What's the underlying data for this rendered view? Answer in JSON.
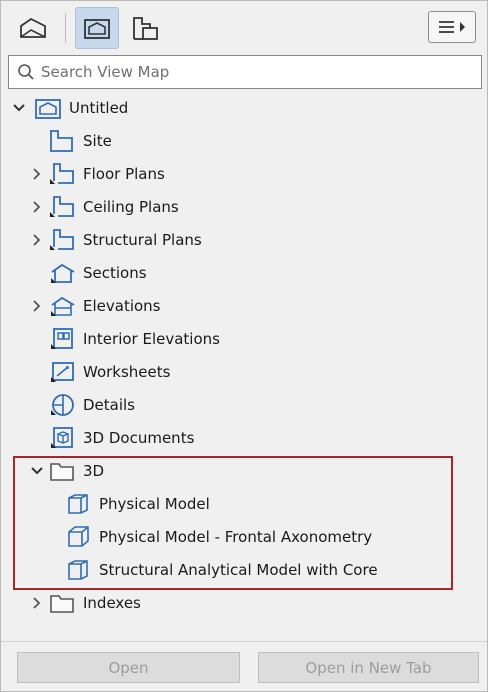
{
  "search": {
    "placeholder": "Search View Map"
  },
  "tree": {
    "root": {
      "label": "Untitled"
    },
    "items": [
      {
        "label": "Site"
      },
      {
        "label": "Floor Plans"
      },
      {
        "label": "Ceiling Plans"
      },
      {
        "label": "Structural Plans"
      },
      {
        "label": "Sections"
      },
      {
        "label": "Elevations"
      },
      {
        "label": "Interior Elevations"
      },
      {
        "label": "Worksheets"
      },
      {
        "label": "Details"
      },
      {
        "label": "3D Documents"
      },
      {
        "label": "3D"
      },
      {
        "label": "Physical Model"
      },
      {
        "label": "Physical Model - Frontal Axonometry"
      },
      {
        "label": "Structural Analytical Model with Core"
      },
      {
        "label": "Indexes"
      }
    ]
  },
  "footer": {
    "open_label": "Open",
    "open_new_tab_label": "Open in New Tab"
  },
  "colors": {
    "highlight_border": "#a4292d",
    "icon_blue": "#2f6db5",
    "active_tab_bg": "#c7d8ec"
  },
  "icons": {
    "toolbar": [
      "project-map-icon",
      "view-map-icon",
      "layout-book-icon",
      "menu-icon"
    ],
    "tree": [
      "house-icon",
      "floor-plan-icon",
      "section-icon",
      "elevation-icon",
      "interior-elevation-icon",
      "worksheet-icon",
      "detail-icon",
      "3d-document-icon",
      "folder-icon",
      "cube-icon"
    ]
  }
}
